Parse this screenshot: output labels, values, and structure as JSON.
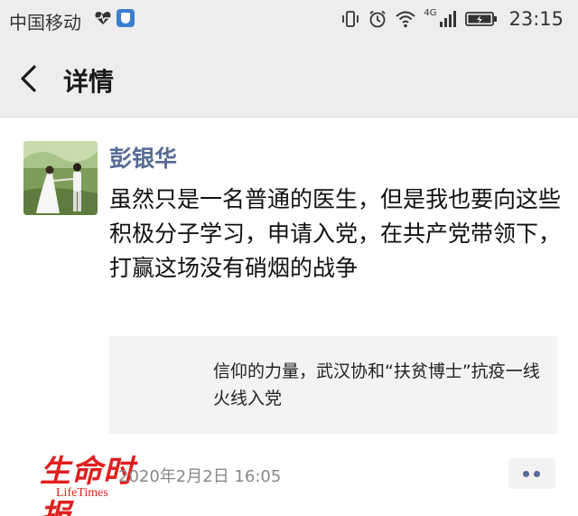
{
  "status_bar": {
    "carrier": "中国移动",
    "network_label": "4G",
    "time": "23:15",
    "icons": [
      "heart-icon",
      "app-badge-icon",
      "vibrate-icon",
      "alarm-icon",
      "wifi-icon",
      "signal-icon",
      "battery-icon"
    ]
  },
  "nav": {
    "title": "详情",
    "back_icon": "chevron-left-icon"
  },
  "post": {
    "author": "彭银华",
    "text": "虽然只是一名普通的医生，但是我也要向这些积极分子学习，申请入党，在共产党带领下，打赢这场没有硝烟的战争",
    "link": {
      "title": "信仰的力量，武汉协和“扶贫博士”抗疫一线火线入党"
    },
    "timestamp": "2020年2月2日 16:05",
    "more_icon": "more-dots-icon"
  },
  "watermark": {
    "cn": "生命时报",
    "en": "LifeTimes"
  },
  "colors": {
    "author_name": "#576b95",
    "bar_background": "#ededed",
    "watermark": "#e0201f"
  }
}
